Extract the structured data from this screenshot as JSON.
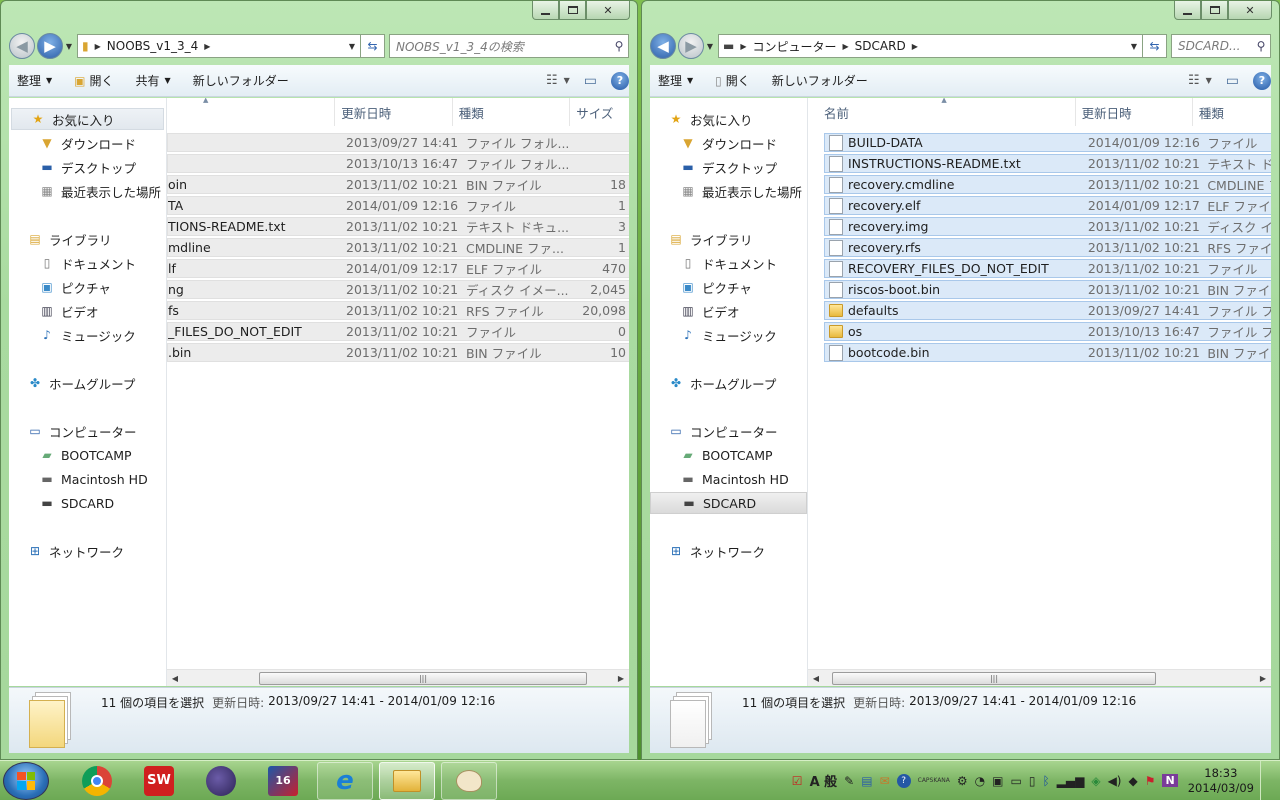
{
  "left_window": {
    "address": {
      "path": [
        "NOOBS_v1_3_4"
      ]
    },
    "search_placeholder": "NOOBS_v1_3_4の検索",
    "toolbar": {
      "organize": "整理",
      "open": "開く",
      "share": "共有",
      "new_folder": "新しいフォルダー"
    },
    "columns": {
      "name": "",
      "date": "更新日時",
      "type": "種類",
      "size": "サイズ"
    },
    "files": [
      {
        "name": "",
        "date": "2013/09/27 14:41",
        "type": "ファイル フォル...",
        "size": ""
      },
      {
        "name": "",
        "date": "2013/10/13 16:47",
        "type": "ファイル フォル...",
        "size": ""
      },
      {
        "name": "oin",
        "date": "2013/11/02 10:21",
        "type": "BIN ファイル",
        "size": "18"
      },
      {
        "name": "TA",
        "date": "2014/01/09 12:16",
        "type": "ファイル",
        "size": "1"
      },
      {
        "name": "TIONS-README.txt",
        "date": "2013/11/02 10:21",
        "type": "テキスト ドキュ...",
        "size": "3"
      },
      {
        "name": "mdline",
        "date": "2013/11/02 10:21",
        "type": "CMDLINE ファ...",
        "size": "1"
      },
      {
        "name": "lf",
        "date": "2014/01/09 12:17",
        "type": "ELF ファイル",
        "size": "470"
      },
      {
        "name": "ng",
        "date": "2013/11/02 10:21",
        "type": "ディスク イメー...",
        "size": "2,045"
      },
      {
        "name": "fs",
        "date": "2013/11/02 10:21",
        "type": "RFS ファイル",
        "size": "20,098"
      },
      {
        "name": "_FILES_DO_NOT_EDIT",
        "date": "2013/11/02 10:21",
        "type": "ファイル",
        "size": "0"
      },
      {
        "name": ".bin",
        "date": "2013/11/02 10:21",
        "type": "BIN ファイル",
        "size": "10"
      }
    ],
    "status": {
      "count": "11 個の項目を選択",
      "date_label": "更新日時:",
      "date_range": "2013/09/27 14:41 - 2014/01/09 12:16"
    }
  },
  "right_window": {
    "address": {
      "path": [
        "コンピューター",
        "SDCARD"
      ]
    },
    "search_placeholder": "SDCARD...",
    "toolbar": {
      "organize": "整理",
      "open": "開く",
      "new_folder": "新しいフォルダー"
    },
    "columns": {
      "name": "名前",
      "date": "更新日時",
      "type": "種類"
    },
    "files": [
      {
        "name": "BUILD-DATA",
        "date": "2014/01/09 12:16",
        "type": "ファイル",
        "icon": "file"
      },
      {
        "name": "INSTRUCTIONS-README.txt",
        "date": "2013/11/02 10:21",
        "type": "テキスト ド",
        "icon": "file"
      },
      {
        "name": "recovery.cmdline",
        "date": "2013/11/02 10:21",
        "type": "CMDLINE ファ",
        "icon": "file"
      },
      {
        "name": "recovery.elf",
        "date": "2014/01/09 12:17",
        "type": "ELF ファイ",
        "icon": "file"
      },
      {
        "name": "recovery.img",
        "date": "2013/11/02 10:21",
        "type": "ディスク イ",
        "icon": "file"
      },
      {
        "name": "recovery.rfs",
        "date": "2013/11/02 10:21",
        "type": "RFS ファイ",
        "icon": "file"
      },
      {
        "name": "RECOVERY_FILES_DO_NOT_EDIT",
        "date": "2013/11/02 10:21",
        "type": "ファイル",
        "icon": "file"
      },
      {
        "name": "riscos-boot.bin",
        "date": "2013/11/02 10:21",
        "type": "BIN ファイ",
        "icon": "file"
      },
      {
        "name": "defaults",
        "date": "2013/09/27 14:41",
        "type": "ファイル フ",
        "icon": "folder"
      },
      {
        "name": "os",
        "date": "2013/10/13 16:47",
        "type": "ファイル フ",
        "icon": "folder"
      },
      {
        "name": "bootcode.bin",
        "date": "2013/11/02 10:21",
        "type": "BIN ファイ",
        "icon": "file"
      }
    ],
    "status": {
      "count": "11 個の項目を選択",
      "date_label": "更新日時:",
      "date_range": "2013/09/27 14:41 - 2014/01/09 12:16"
    }
  },
  "nav": {
    "favorites": "お気に入り",
    "downloads": "ダウンロード",
    "desktop": "デスクトップ",
    "recent": "最近表示した場所",
    "libraries": "ライブラリ",
    "documents": "ドキュメント",
    "pictures": "ピクチャ",
    "videos": "ビデオ",
    "music": "ミュージック",
    "homegroup": "ホームグループ",
    "computer": "コンピューター",
    "bootcamp": "BOOTCAMP",
    "macintosh": "Macintosh HD",
    "sdcard": "SDCARD",
    "network": "ネットワーク"
  },
  "taskbar": {
    "ime": "A 般",
    "caps": "CAPS",
    "kana": "KANA",
    "time": "18:33",
    "date": "2014/03/09"
  },
  "colors": {
    "selection": "#dbe9f8",
    "selection_border": "#a9c8ea",
    "taskbar": "#7db565"
  }
}
